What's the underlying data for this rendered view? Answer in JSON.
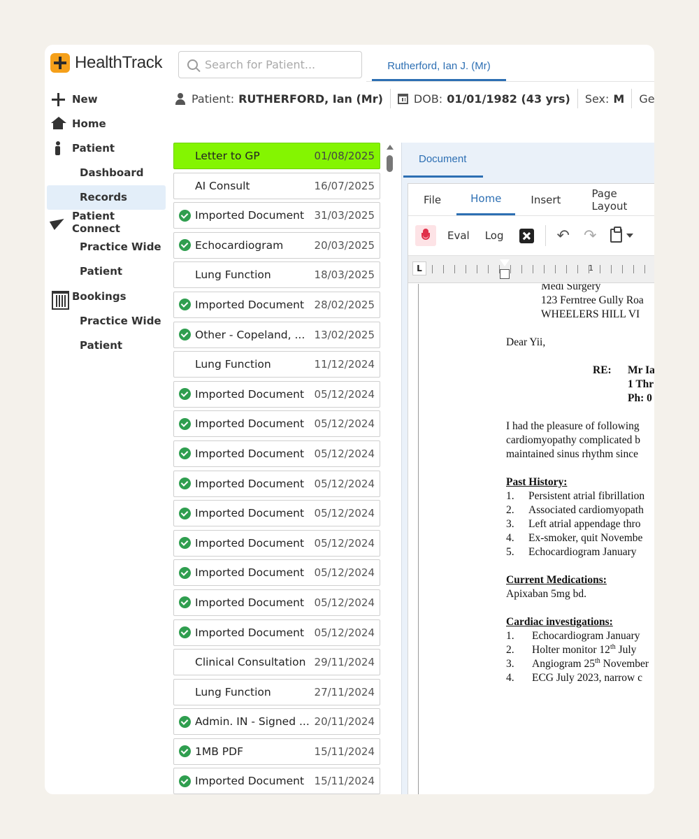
{
  "app": {
    "logo_text": "HealthTrack",
    "search_placeholder": "Search for Patient...",
    "open_tab": "Rutherford, Ian J. (Mr)"
  },
  "patient_bar": {
    "patient_label": "Patient:",
    "patient_value": "RUTHERFORD, Ian (Mr)",
    "dob_label": "DOB:",
    "dob_value": "01/01/1982 (43 yrs)",
    "sex_label": "Sex:",
    "sex_value": "M",
    "gender_label": "Gen"
  },
  "sidebar": {
    "new": "New",
    "home": "Home",
    "patient": "Patient",
    "patient_items": [
      "Dashboard",
      "Records"
    ],
    "patient_connect": "Patient Connect",
    "connect_items": [
      "Practice Wide",
      "Patient"
    ],
    "bookings": "Bookings",
    "booking_items": [
      "Practice Wide",
      "Patient"
    ],
    "active_item": "Records"
  },
  "records": [
    {
      "name": "Letter to GP",
      "date": "01/08/2025",
      "checked": false,
      "highlight": true
    },
    {
      "name": "AI Consult",
      "date": "16/07/2025",
      "checked": false
    },
    {
      "name": "Imported Document",
      "date": "31/03/2025",
      "checked": true
    },
    {
      "name": "Echocardiogram",
      "date": "20/03/2025",
      "checked": true
    },
    {
      "name": "Lung Function",
      "date": "18/03/2025",
      "checked": false
    },
    {
      "name": "Imported Document",
      "date": "28/02/2025",
      "checked": true
    },
    {
      "name": "Other - Copeland, ...",
      "date": "13/02/2025",
      "checked": true
    },
    {
      "name": "Lung Function",
      "date": "11/12/2024",
      "checked": false
    },
    {
      "name": "Imported Document",
      "date": "05/12/2024",
      "checked": true
    },
    {
      "name": "Imported Document",
      "date": "05/12/2024",
      "checked": true
    },
    {
      "name": "Imported Document",
      "date": "05/12/2024",
      "checked": true
    },
    {
      "name": "Imported Document",
      "date": "05/12/2024",
      "checked": true
    },
    {
      "name": "Imported Document",
      "date": "05/12/2024",
      "checked": true
    },
    {
      "name": "Imported Document",
      "date": "05/12/2024",
      "checked": true
    },
    {
      "name": "Imported Document",
      "date": "05/12/2024",
      "checked": true
    },
    {
      "name": "Imported Document",
      "date": "05/12/2024",
      "checked": true
    },
    {
      "name": "Imported Document",
      "date": "05/12/2024",
      "checked": true
    },
    {
      "name": "Clinical Consultation",
      "date": "29/11/2024",
      "checked": false
    },
    {
      "name": "Lung Function",
      "date": "27/11/2024",
      "checked": false
    },
    {
      "name": "Admin. IN - Signed ...",
      "date": "20/11/2024",
      "checked": true
    },
    {
      "name": "1MB PDF",
      "date": "15/11/2024",
      "checked": true
    },
    {
      "name": "Imported Document",
      "date": "15/11/2024",
      "checked": true
    }
  ],
  "document": {
    "tab": "Document",
    "ribbon_tabs": [
      "File",
      "Home",
      "Insert",
      "Page Layout"
    ],
    "active_ribbon_tab": "Home",
    "toolbar": {
      "eval": "Eval",
      "log": "Log"
    },
    "ruler_mark": "1",
    "ruler_corner": "L",
    "letter": {
      "addr_lines": [
        "Medi Surgery",
        "123 Ferntree Gully Roa",
        "WHEELERS HILL VI"
      ],
      "salutation": "Dear Yii,",
      "re_label": "RE:",
      "re_lines": [
        "Mr Ia",
        "1 Thr",
        "Ph: 0"
      ],
      "para": [
        "I had the pleasure of following",
        "cardiomyopathy complicated b",
        "maintained sinus rhythm since"
      ],
      "past_history_head": "Past History:",
      "past_history": [
        "Persistent atrial fibrillation",
        "Associated cardiomyopath",
        "Left atrial appendage thro",
        "Ex-smoker, quit Novembe",
        "Echocardiogram January"
      ],
      "medications_head": "Current Medications:",
      "medications": "Apixaban 5mg bd.",
      "cardiac_head": "Cardiac investigations:",
      "cardiac_1": "Echocardiogram January",
      "cardiac_2_pre": "Holter monitor 12",
      "cardiac_2_sup": "th",
      "cardiac_2_post": " July",
      "cardiac_3_pre": "Angiogram 25",
      "cardiac_3_sup": "th",
      "cardiac_3_post": " November",
      "cardiac_4": "ECG July 2023, narrow c"
    }
  },
  "colors": {
    "accent": "#2d6fb3",
    "highlight": "#84f501",
    "check": "#2f9e4f",
    "logo": "#f5a01a"
  }
}
